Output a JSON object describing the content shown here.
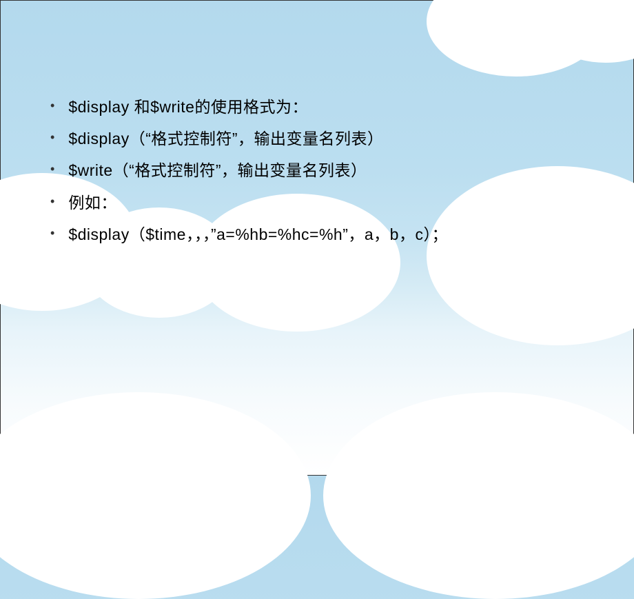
{
  "bullets": [
    "$display 和$write的使用格式为：",
    "$display（“格式控制符”，输出变量名列表）",
    "$write（“格式控制符”，输出变量名列表）",
    "例如：",
    "$display（$time，，，”a=%hb=%hc=%h”，a，b，c）；"
  ]
}
